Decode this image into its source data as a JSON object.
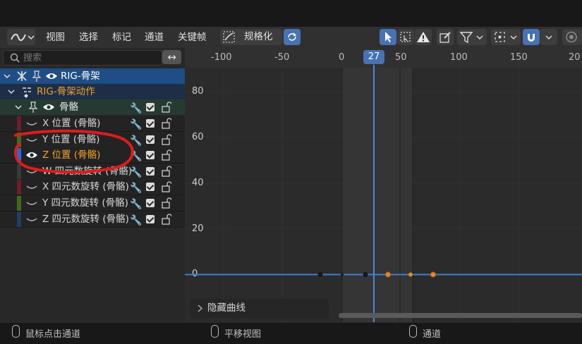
{
  "header": {
    "menus": [
      "视图",
      "选择",
      "标记",
      "通道",
      "关键帧"
    ],
    "normalize_label": "规格化"
  },
  "search": {
    "placeholder": "搜索"
  },
  "channels": {
    "object": "RIG-骨架",
    "action": "RIG-骨架动作",
    "group": "骨骼",
    "items": [
      {
        "label": "X 位置 (骨骼)",
        "color": "#6e1d2a",
        "selected": false
      },
      {
        "label": "Y 位置 (骨骼)",
        "color": "#3d6b1a",
        "selected": false
      },
      {
        "label": "Z 位置 (骨骼)",
        "color": "#2a6ad6",
        "selected": true
      },
      {
        "label": "W 四元数旋转 (骨骼)",
        "color": "#3a3a3a",
        "selected": false
      },
      {
        "label": "X 四元数旋转 (骨骼)",
        "color": "#6e1d2a",
        "selected": false
      },
      {
        "label": "Y 四元数旋转 (骨骼)",
        "color": "#3d6b1a",
        "selected": false
      },
      {
        "label": "Z 四元数旋转 (骨骼)",
        "color": "#1d3d6e",
        "selected": false
      }
    ]
  },
  "graph": {
    "current_frame": "27",
    "x_ticks": [
      "-100",
      "-50",
      "0",
      "50",
      "100",
      "150",
      "20"
    ],
    "y_ticks": [
      "80",
      "60",
      "40",
      "20",
      "0"
    ],
    "hidden_curves_label": "隐藏曲线",
    "accent": "#4772b3",
    "curve_color": "#3b7fd1",
    "keyframe_selected_color": "#e8862e"
  },
  "footer": {
    "left": "鼠标点击通道",
    "middle": "平移视图",
    "right": "通道"
  }
}
